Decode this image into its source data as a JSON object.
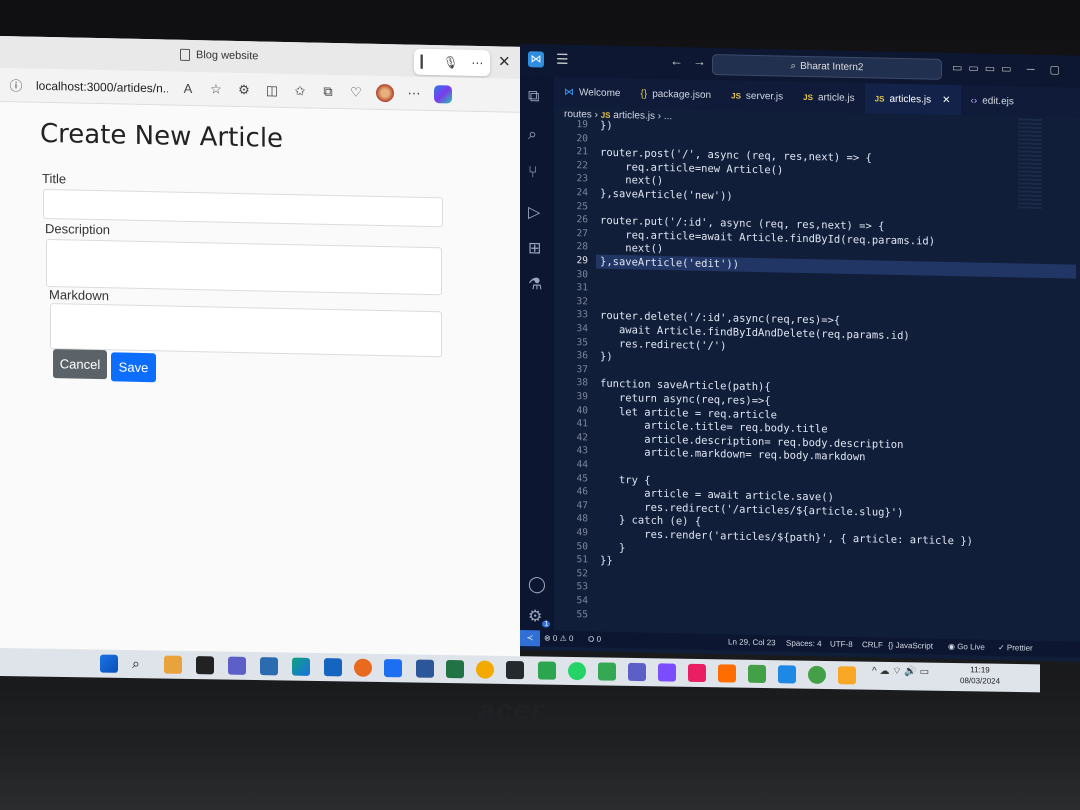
{
  "browser": {
    "tab_title": "Blog website",
    "address": "localhost:3000/artides/n...",
    "page": {
      "heading": "Create New Article",
      "fields": [
        {
          "label": "Title"
        },
        {
          "label": "Description"
        },
        {
          "label": "Markdown"
        }
      ],
      "cancel_label": "Cancel",
      "save_label": "Save"
    }
  },
  "vscode": {
    "search_text": "Bharat Intern2",
    "tabs": [
      {
        "label": "Welcome",
        "icon": "vscode-icon"
      },
      {
        "label": "package.json",
        "icon": "json-icon"
      },
      {
        "label": "server.js",
        "icon": "js-icon"
      },
      {
        "label": "article.js",
        "icon": "js-icon"
      },
      {
        "label": "articles.js",
        "icon": "js-icon",
        "active": true
      },
      {
        "label": "edit.ejs",
        "icon": "ejs-icon"
      }
    ],
    "breadcrumb": [
      "routes",
      "articles.js",
      "..."
    ],
    "current_line": 29,
    "code": [
      {
        "n": "19",
        "t": "})"
      },
      {
        "n": "20",
        "t": ""
      },
      {
        "n": "21",
        "t": "router.post('/', async (req, res,next) => {"
      },
      {
        "n": "22",
        "t": "    req.article=new Article()"
      },
      {
        "n": "23",
        "t": "    next()"
      },
      {
        "n": "24",
        "t": "},saveArticle('new'))"
      },
      {
        "n": "25",
        "t": ""
      },
      {
        "n": "26",
        "t": "router.put('/:id', async (req, res,next) => {"
      },
      {
        "n": "27",
        "t": "    req.article=await Article.findById(req.params.id)"
      },
      {
        "n": "28",
        "t": "    next()"
      },
      {
        "n": "29",
        "t": "},saveArticle('edit'))"
      },
      {
        "n": "30",
        "t": ""
      },
      {
        "n": "31",
        "t": ""
      },
      {
        "n": "32",
        "t": ""
      },
      {
        "n": "33",
        "t": "router.delete('/:id',async(req,res)=>{"
      },
      {
        "n": "34",
        "t": "   await Article.findByIdAndDelete(req.params.id)"
      },
      {
        "n": "35",
        "t": "   res.redirect('/')"
      },
      {
        "n": "36",
        "t": "})"
      },
      {
        "n": "37",
        "t": ""
      },
      {
        "n": "38",
        "t": "function saveArticle(path){"
      },
      {
        "n": "39",
        "t": "   return async(req,res)=>{"
      },
      {
        "n": "40",
        "t": "   let article = req.article"
      },
      {
        "n": "41",
        "t": "       article.title= req.body.title"
      },
      {
        "n": "42",
        "t": "       article.description= req.body.description"
      },
      {
        "n": "43",
        "t": "       article.markdown= req.body.markdown"
      },
      {
        "n": "44",
        "t": ""
      },
      {
        "n": "45",
        "t": "   try {"
      },
      {
        "n": "46",
        "t": "       article = await article.save()"
      },
      {
        "n": "47",
        "t": "       res.redirect('/articles/${article.slug}')"
      },
      {
        "n": "48",
        "t": "   } catch (e) {"
      },
      {
        "n": "49",
        "t": "       res.render('articles/${path}', { article: article })"
      },
      {
        "n": "50",
        "t": "   }"
      },
      {
        "n": "51",
        "t": "}}"
      },
      {
        "n": "52",
        "t": ""
      },
      {
        "n": "53",
        "t": ""
      },
      {
        "n": "54",
        "t": ""
      },
      {
        "n": "55",
        "t": ""
      }
    ],
    "status": {
      "problems": "⊗ 0 ⚠ 0",
      "ports": "⛭ 0",
      "position": "Ln 29, Col 23",
      "spaces": "Spaces: 4",
      "encoding": "UTF-8",
      "eol": "CRLF",
      "language": "{} JavaScript",
      "golive": "Go Live",
      "prettier": "✓ Prettier"
    },
    "activity_badge": "1"
  },
  "taskbar": {
    "time": "11:19",
    "date": "08/03/2024"
  },
  "hardware": {
    "brand": "acer"
  }
}
